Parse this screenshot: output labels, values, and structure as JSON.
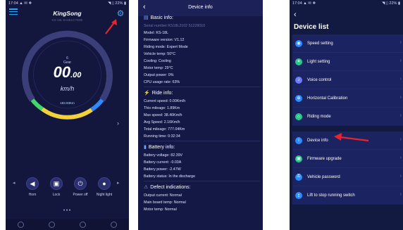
{
  "phone1": {
    "status": {
      "time": "17:04",
      "icons": "▲ ✉ ❖",
      "right": "◥ ▯ 22% ▮"
    },
    "title": "KingSong",
    "serial": "KS-18L 8A4B1C7D9E",
    "gear_label": "Gear",
    "gear_value": "6",
    "speed_int": "00",
    "speed_dec": ".00",
    "unit": "km/h",
    "mileage": "183.93Km",
    "controls": [
      {
        "label": "Horn",
        "icon": "horn-icon",
        "glyph": "📢"
      },
      {
        "label": "Lock",
        "icon": "lock-icon",
        "glyph": "🔒"
      },
      {
        "label": "Power off",
        "icon": "power-icon",
        "glyph": "⏻"
      },
      {
        "label": "Night light",
        "icon": "light-icon",
        "glyph": "●"
      }
    ],
    "arc_colors": {
      "track": "#3a3f7a",
      "green": "#43d66a",
      "yellow": "#f2d23a",
      "blue": "#2e8bff"
    }
  },
  "phone2": {
    "title": "Device info",
    "sections": [
      {
        "name": "Basic info:",
        "rows": [
          {
            "text": "Serial number:KS18L2102 51229010",
            "dim": true
          },
          {
            "text": "Model: KS-18L",
            "dim": false
          },
          {
            "text": "Firmware version: V1.12",
            "dim": false
          },
          {
            "text": "Riding mode: Expert Mode",
            "dim": false
          },
          {
            "text": "Vehicle temp: 50°C",
            "dim": false
          },
          {
            "text": "Cooling: Cooling",
            "dim": false
          },
          {
            "text": "Motor temp: 29°C",
            "dim": false
          },
          {
            "text": "Output power: 0%",
            "dim": false
          },
          {
            "text": "CPU usage rate: 63%",
            "dim": false
          }
        ]
      },
      {
        "name": "Ride info:",
        "rows": [
          {
            "text": "Current speed: 0.00Km/h",
            "dim": false
          },
          {
            "text": "This mileage: 1.89Km",
            "dim": false
          },
          {
            "text": "Max speed: 38.40Km/h",
            "dim": false
          },
          {
            "text": "Avg Speed: 2.16Km/h",
            "dim": false
          },
          {
            "text": "Total mileage: 777.04Km",
            "dim": false
          },
          {
            "text": "Running time: 0:32:34",
            "dim": false
          }
        ]
      },
      {
        "name": "Battery info:",
        "rows": [
          {
            "text": "Battery voltage: 82.39V",
            "dim": false
          },
          {
            "text": "Battery current: -0.03A",
            "dim": false
          },
          {
            "text": "Battery power: -2.47W",
            "dim": false
          },
          {
            "text": "Battery status: In the discharge",
            "dim": false
          }
        ]
      },
      {
        "name": "Defect indications:",
        "rows": [
          {
            "text": "Output current: Normal",
            "dim": false
          },
          {
            "text": "Main board temp: Normal",
            "dim": false
          },
          {
            "text": "Motor temp: Normal",
            "dim": false
          }
        ]
      }
    ]
  },
  "phone3": {
    "status": {
      "time": "17:04",
      "icons": "▲ ✉ ❖",
      "right": "◥ ▯ 22% ▮"
    },
    "title": "Device list",
    "groups": [
      [
        {
          "label": "Speed setting",
          "icon": "speed-icon",
          "glyph": "◉",
          "color": "#2a8dff"
        },
        {
          "label": "Light setting",
          "icon": "light-icon",
          "glyph": "✦",
          "color": "#27c98b"
        },
        {
          "label": "Voice control",
          "icon": "voice-icon",
          "glyph": "♪",
          "color": "#6b7dff"
        },
        {
          "label": "Horizontal Calibration",
          "icon": "calibration-icon",
          "glyph": "⊕",
          "color": "#2a8dff"
        },
        {
          "label": "Riding mode",
          "icon": "riding-icon",
          "glyph": "⌂",
          "color": "#27c98b"
        }
      ],
      [
        {
          "label": "Device info",
          "icon": "info-icon",
          "glyph": "i",
          "color": "#2a8dff"
        },
        {
          "label": "Firmware upgrade",
          "icon": "firmware-icon",
          "glyph": "▣",
          "color": "#27c98b"
        },
        {
          "label": "Vehicle password",
          "icon": "password-icon",
          "glyph": "⚿",
          "color": "#2a8dff"
        },
        {
          "label": "Lift to stop running switch",
          "icon": "lift-icon",
          "glyph": "↥",
          "color": "#2a8dff"
        }
      ]
    ]
  },
  "annotation_color": "#e8262a"
}
